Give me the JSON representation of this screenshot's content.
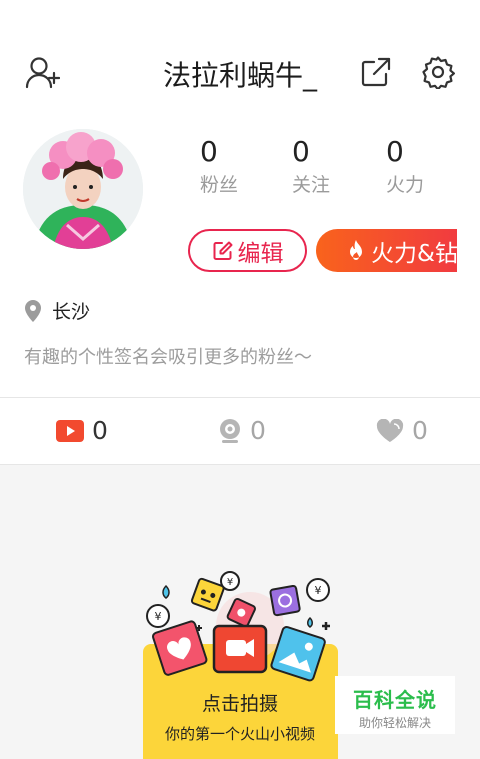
{
  "header": {
    "title": "法拉利蜗牛_",
    "left_icon": "add-user-icon",
    "right_icons": [
      "share-icon",
      "gear-icon"
    ]
  },
  "profile": {
    "avatar": "avatar",
    "stats": [
      {
        "value": "0",
        "label": "粉丝"
      },
      {
        "value": "0",
        "label": "关注"
      },
      {
        "value": "0",
        "label": "火力"
      }
    ],
    "edit_label": "编辑",
    "fire_label": "火力&钻石",
    "location": "长沙",
    "bio_placeholder": "有趣的个性签名会吸引更多的粉丝～"
  },
  "tabs": [
    {
      "icon": "video-icon",
      "count": "0",
      "active": true
    },
    {
      "icon": "camera-icon",
      "count": "0",
      "active": false
    },
    {
      "icon": "heart-icon",
      "count": "0",
      "active": false
    }
  ],
  "empty_state": {
    "cta": "点击拍摄",
    "subtitle": "你的第一个火山小视频"
  },
  "watermark": {
    "title": "百科全说",
    "subtitle": "助你轻松解决"
  },
  "colors": {
    "accent": "#e8254e",
    "fire_gradient_start": "#f9631c",
    "fire_gradient_end": "#ee2d4c",
    "empty_bg": "#f5f5f5",
    "card_yellow": "#fcd53a",
    "watermark_green": "#2bbd4c"
  }
}
